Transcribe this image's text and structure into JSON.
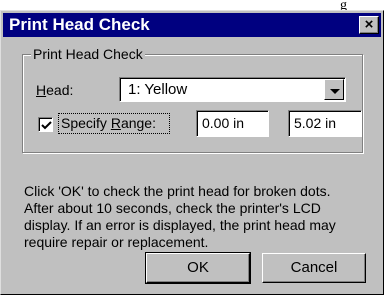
{
  "background_fragment": "g",
  "dialog": {
    "title": "Print Head Check",
    "close_label": "×"
  },
  "group": {
    "legend": "Print Head Check",
    "head_label_underlined": "H",
    "head_label_rest": "ead:",
    "head_value": "1: Yellow",
    "specify_checked": true,
    "specify_label_pre": "Specify ",
    "specify_label_underlined": "R",
    "specify_label_post": "ange:",
    "range_start": "0.00 in",
    "range_end": "5.02 in"
  },
  "description_lines": [
    "Click 'OK' to check the print head for broken dots.",
    "After about 10 seconds, check the printer's LCD",
    "display.  If an error is displayed, the print head may",
    "require repair or replacement."
  ],
  "buttons": {
    "ok": "OK",
    "cancel": "Cancel"
  }
}
